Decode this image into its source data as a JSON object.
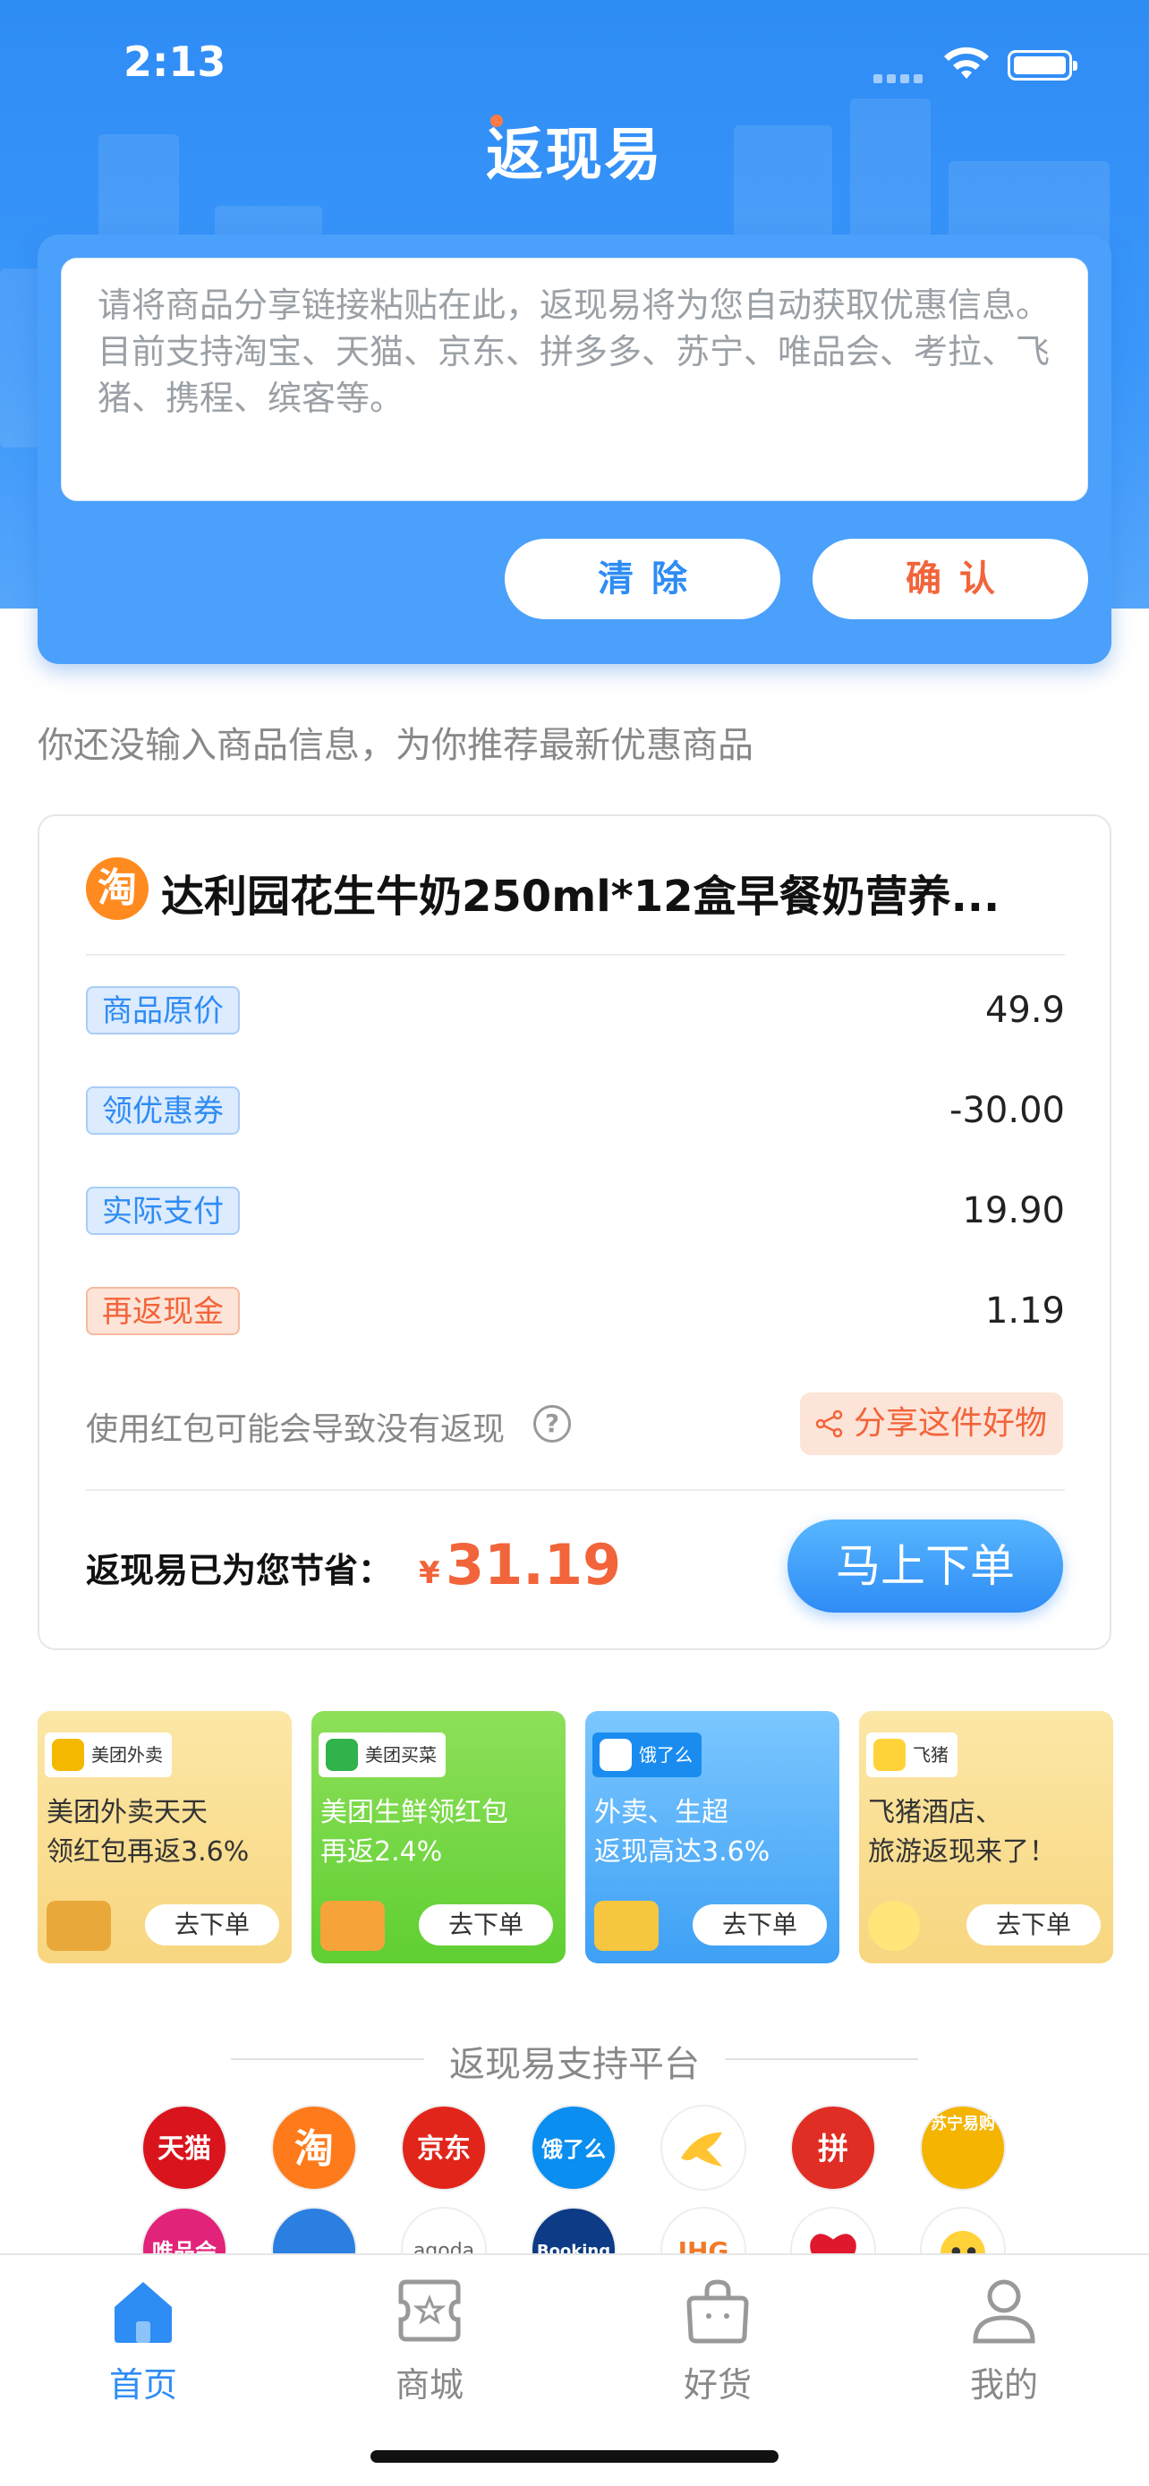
{
  "status_bar": {
    "time": "2:13"
  },
  "header": {
    "logo_text": "返现易"
  },
  "input": {
    "placeholder": "请将商品分享链接粘贴在此，返现易将为您自动获取优惠信息。目前支持淘宝、天猫、京东、拼多多、苏宁、唯品会、考拉、飞猪、携程、缤客等。",
    "clear_label": "清除",
    "confirm_label": "确认"
  },
  "hint_text": "你还没输入商品信息，为你推荐最新优惠商品",
  "product": {
    "platform_icon": "淘",
    "title": "达利园花生牛奶250ml*12盒早餐奶营养...",
    "rows": [
      {
        "label": "商品原价",
        "value": "49.9"
      },
      {
        "label": "领优惠券",
        "value": "-30.00"
      },
      {
        "label": "实际支付",
        "value": "19.90"
      },
      {
        "label": "再返现金",
        "value": "1.19"
      }
    ],
    "note": "使用红包可能会导致没有返现",
    "share_label": "分享这件好物",
    "save_label": "返现易已为您节省：",
    "currency": "¥",
    "save_amount": "31.19",
    "order_label": "马上下单"
  },
  "promos": [
    {
      "badge": "美团外卖",
      "line1": "美团外卖天天",
      "line2": "领红包再返3.6%",
      "button": "去下单"
    },
    {
      "badge": "美团买菜",
      "line1": "美团生鲜领红包",
      "line2": "再返2.4%",
      "button": "去下单"
    },
    {
      "badge": "饿了么",
      "line1": "外卖、生超",
      "line2": "返现高达3.6%",
      "button": "去下单"
    },
    {
      "badge": "飞猪",
      "line1": "飞猪酒店、",
      "line2": "旅游返现来了！",
      "button": "去下单"
    }
  ],
  "platforms_title": "返现易支持平台",
  "platforms": [
    {
      "label": "天猫",
      "color": "#d9141d"
    },
    {
      "label": "淘",
      "color": "#ff7a1a"
    },
    {
      "label": "京东",
      "color": "#e1251b"
    },
    {
      "label": "饿了么",
      "color": "#0a8ef0"
    },
    {
      "label": "",
      "color": "#ffc430"
    },
    {
      "label": "拼",
      "color": "#e02e24"
    },
    {
      "label": "苏宁易购",
      "color": "#f4b400"
    },
    {
      "label": "唯品会",
      "color": "#e2237a"
    },
    {
      "label": "",
      "color": "#2a7fe0"
    },
    {
      "label": "agoda",
      "color": "#ffffff"
    },
    {
      "label": "Booking",
      "color": "#0d3b85"
    },
    {
      "label": "IHG",
      "color": "#ffffff"
    },
    {
      "label": "",
      "color": "#e0182e"
    },
    {
      "label": "",
      "color": "#ffd23a"
    }
  ],
  "tabs": [
    {
      "label": "首页",
      "icon": "home-icon"
    },
    {
      "label": "商城",
      "icon": "shop-icon"
    },
    {
      "label": "好货",
      "icon": "bag-icon"
    },
    {
      "label": "我的",
      "icon": "user-icon"
    }
  ],
  "colors": {
    "primary": "#2e8cf5",
    "accent": "#f2643a"
  }
}
